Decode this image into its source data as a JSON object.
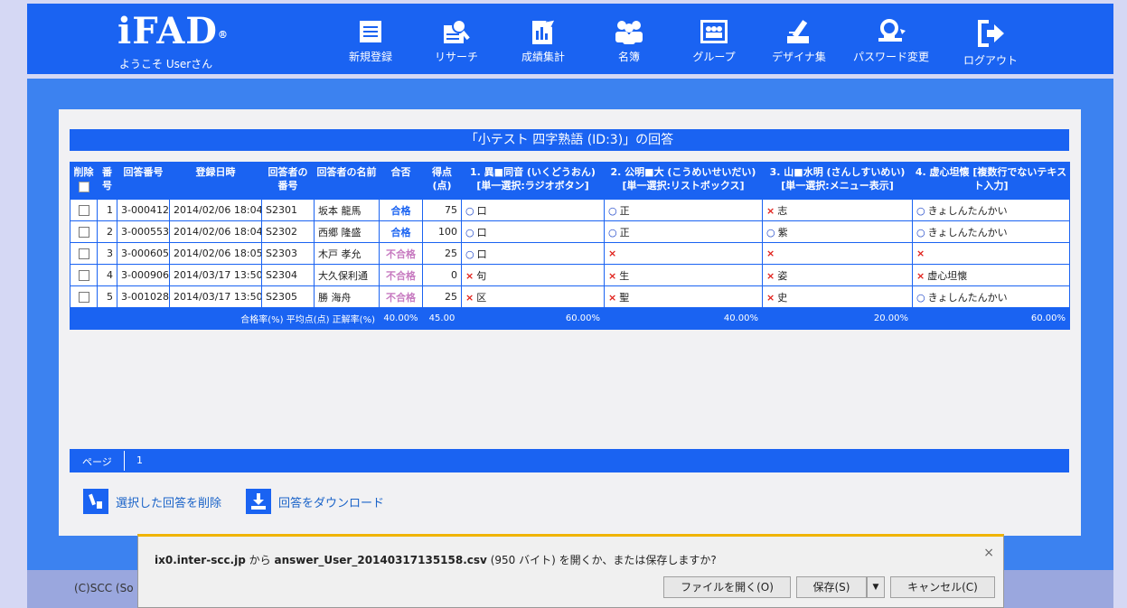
{
  "header": {
    "logo": "iFAD",
    "logo_mark": "®",
    "welcome": "ようこそ Userさん",
    "nav": [
      {
        "label": "新規登録",
        "icon": "document-icon"
      },
      {
        "label": "リサーチ",
        "icon": "search-document-icon"
      },
      {
        "label": "成績集計",
        "icon": "chart-document-icon"
      },
      {
        "label": "名簿",
        "icon": "people-icon"
      },
      {
        "label": "グループ",
        "icon": "group-icon"
      },
      {
        "label": "デザイナ集",
        "icon": "pencil-icon"
      },
      {
        "label": "パスワード変更",
        "icon": "key-icon"
      },
      {
        "label": "ログアウト",
        "icon": "logout-icon"
      }
    ]
  },
  "main": {
    "title": "「小テスト 四字熟語 (ID:3)」の回答",
    "columns": {
      "delete": "削除",
      "num": "番号",
      "answer_no": "回答番号",
      "date": "登録日時",
      "resp_no": "回答者の番号",
      "resp_name": "回答者の名前",
      "pass": "合否",
      "score": "得点(点)",
      "q1": "1. 異■同音 (いくどうおん) [単一選択:ラジオボタン]",
      "q2": "2. 公明■大 (こうめいせいだい) [単一選択:リストボックス]",
      "q3": "3. 山■水明 (さんしすいめい) [単一選択:メニュー表示]",
      "q4": "4. 虚心坦懐 [複数行でないテキスト入力]"
    },
    "rows": [
      {
        "num": "1",
        "answer_no": "3-000412",
        "date": "2014/02/06 18:04",
        "resp_no": "S2301",
        "resp_name": "坂本 龍馬",
        "pass": "合格",
        "pass_ok": true,
        "score": "75",
        "q1": {
          "mark": "o",
          "text": "口"
        },
        "q2": {
          "mark": "o",
          "text": "正"
        },
        "q3": {
          "mark": "x",
          "text": "志"
        },
        "q4": {
          "mark": "o",
          "text": "きょしんたんかい"
        }
      },
      {
        "num": "2",
        "answer_no": "3-000553",
        "date": "2014/02/06 18:04",
        "resp_no": "S2302",
        "resp_name": "西郷 隆盛",
        "pass": "合格",
        "pass_ok": true,
        "score": "100",
        "q1": {
          "mark": "o",
          "text": "口"
        },
        "q2": {
          "mark": "o",
          "text": "正"
        },
        "q3": {
          "mark": "o",
          "text": "紫"
        },
        "q4": {
          "mark": "o",
          "text": "きょしんたんかい"
        }
      },
      {
        "num": "3",
        "answer_no": "3-000605",
        "date": "2014/02/06 18:05",
        "resp_no": "S2303",
        "resp_name": "木戸 孝允",
        "pass": "不合格",
        "pass_ok": false,
        "score": "25",
        "q1": {
          "mark": "o",
          "text": "口"
        },
        "q2": {
          "mark": "x",
          "text": ""
        },
        "q3": {
          "mark": "x",
          "text": ""
        },
        "q4": {
          "mark": "x",
          "text": ""
        }
      },
      {
        "num": "4",
        "answer_no": "3-000906",
        "date": "2014/03/17 13:50",
        "resp_no": "S2304",
        "resp_name": "大久保利通",
        "pass": "不合格",
        "pass_ok": false,
        "score": "0",
        "q1": {
          "mark": "x",
          "text": "句"
        },
        "q2": {
          "mark": "x",
          "text": "生"
        },
        "q3": {
          "mark": "x",
          "text": "姿"
        },
        "q4": {
          "mark": "x",
          "text": "虚心坦懐"
        }
      },
      {
        "num": "5",
        "answer_no": "3-001028",
        "date": "2014/03/17 13:50",
        "resp_no": "S2305",
        "resp_name": "勝 海舟",
        "pass": "不合格",
        "pass_ok": false,
        "score": "25",
        "q1": {
          "mark": "x",
          "text": "区"
        },
        "q2": {
          "mark": "x",
          "text": "聖"
        },
        "q3": {
          "mark": "x",
          "text": "史"
        },
        "q4": {
          "mark": "o",
          "text": "きょしんたんかい"
        }
      }
    ],
    "summary": {
      "label": "合格率(%) 平均点(点) 正解率(%)",
      "pass_rate": "40.00%",
      "avg": "45.00",
      "q1": "60.00%",
      "q2": "40.00%",
      "q3": "20.00%",
      "q4": "60.00%"
    },
    "pager": {
      "label": "ページ",
      "page": "1"
    },
    "actions": {
      "delete": "選択した回答を削除",
      "download": "回答をダウンロード"
    }
  },
  "footer": {
    "copyright": "(C)SCC (So"
  },
  "dialog": {
    "host": "ix0.inter-scc.jp",
    "from": " から ",
    "filename": "answer_User_20140317135158.csv",
    "rest": " (950 バイト) を開くか、または保存しますか?",
    "close": "×",
    "open": "ファイルを開く(O)",
    "save": "保存(S)",
    "dropdown": "▼",
    "cancel": "キャンセル(C)"
  },
  "colors": {
    "brand": "#1a63f2",
    "pass": "#1a63f2",
    "fail": "#c77ac0",
    "wrong": "#e0201a"
  }
}
